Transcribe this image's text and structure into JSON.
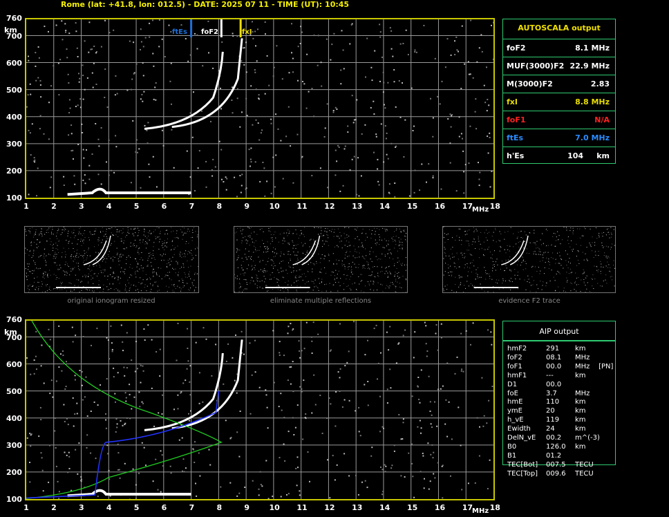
{
  "header": {
    "title": "Rome (lat: +41.8, lon: 012.5) - DATE: 2025 07 11 - TIME (UT): 10:45"
  },
  "ionogram": {
    "y_unit": "km",
    "x_unit": "MHz",
    "y_ticks": [
      "760",
      "700",
      "600",
      "500",
      "400",
      "300",
      "200",
      "100"
    ],
    "x_ticks": [
      "1",
      "2",
      "3",
      "4",
      "5",
      "6",
      "7",
      "8",
      "9",
      "10",
      "11",
      "12",
      "13",
      "14",
      "15",
      "16",
      "17",
      "18"
    ],
    "markers": {
      "ftEs": "ftEs",
      "foF2": "foF2",
      "fxI": "fxI"
    },
    "colors": {
      "grid": "#9a9a9a",
      "frame": "#c8c800",
      "ftEs": "#1e6fd9",
      "foF2": "#ffffff",
      "fxI": "#f0e000",
      "profile_green": "#22cc22",
      "profile_blue": "#2233ff"
    }
  },
  "autoscala": {
    "title": "AUTOSCALA output",
    "rows": [
      {
        "label": "foF2",
        "value": "8.1 MHz",
        "color": "#ffffff"
      },
      {
        "label": "MUF(3000)F2",
        "value": "22.9 MHz",
        "color": "#ffffff"
      },
      {
        "label": "M(3000)F2",
        "value": "2.83",
        "color": "#ffffff"
      },
      {
        "label": "fxI",
        "value": "8.8 MHz",
        "color": "#e8dd00"
      },
      {
        "label": "foF1",
        "value": "N/A",
        "color": "#ff2222"
      },
      {
        "label": "ftEs",
        "value": "7.0 MHz",
        "color": "#2b8cff"
      },
      {
        "label": "h'Es",
        "value": "104     km",
        "color": "#ffffff"
      }
    ]
  },
  "thumbnails": {
    "captions": [
      "original ionogram resized",
      "eliminate multiple reflections",
      "evidence F2 trace"
    ]
  },
  "aip": {
    "title": "AIP output",
    "rows": [
      {
        "k": "hmF2",
        "v": "291",
        "u": "km"
      },
      {
        "k": "foF2",
        "v": "08.1",
        "u": "MHz"
      },
      {
        "k": "foF1",
        "v": "00.0",
        "u": "MHz    [PN]"
      },
      {
        "k": "hmF1",
        "v": "---",
        "u": "km"
      },
      {
        "k": "D1",
        "v": "00.0",
        "u": ""
      },
      {
        "k": "foE",
        "v": "3.7",
        "u": "MHz"
      },
      {
        "k": "hmE",
        "v": "110",
        "u": "km"
      },
      {
        "k": "ymE",
        "v": "20",
        "u": "km"
      },
      {
        "k": "h_vE",
        "v": "119",
        "u": "km"
      },
      {
        "k": "Ewidth",
        "v": "24",
        "u": "km"
      },
      {
        "k": "DelN_vE",
        "v": "00.2",
        "u": "m^(-3)"
      },
      {
        "k": "B0",
        "v": "126.0",
        "u": "km"
      },
      {
        "k": "B1",
        "v": "01.2",
        "u": ""
      },
      {
        "k": "TEC[Bot]",
        "v": "007.5",
        "u": "TECU"
      },
      {
        "k": "TEC[Top]",
        "v": "009.6",
        "u": "TECU"
      }
    ]
  }
}
